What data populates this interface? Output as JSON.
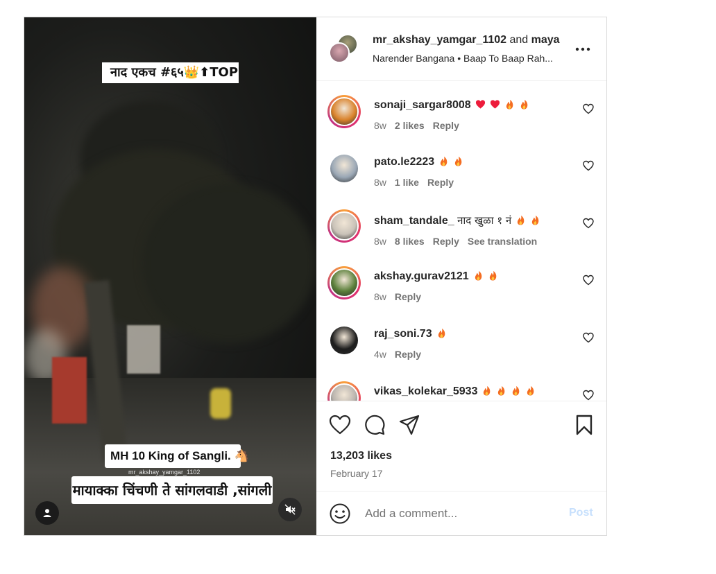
{
  "video": {
    "caption_top": "नाद एकच #६५👑⬆TOP",
    "caption_mh": "MH 10 King of Sangli. 🐴",
    "watermark": "mr_akshay_yamgar_1102",
    "caption_place": "मायाक्का चिंचणी ते सांगलवाडी ,सांगली"
  },
  "header": {
    "user1": "mr_akshay_yamgar_1102",
    "and": "and",
    "user2": "maya",
    "subtitle": "Narender Bangana • Baap To Baap Rah..."
  },
  "comments": [
    {
      "user": "sonaji_sargar8008",
      "text": "",
      "emojis": [
        "heart",
        "heart",
        "fire",
        "fire"
      ],
      "time": "8w",
      "likes": "2 likes",
      "reply": "Reply",
      "translate": "",
      "ring": true,
      "avatar_color": "#d9822b"
    },
    {
      "user": "pato.le2223",
      "text": "",
      "emojis": [
        "fire",
        "fire"
      ],
      "time": "8w",
      "likes": "1 like",
      "reply": "Reply",
      "translate": "",
      "ring": false,
      "avatar_color": "#9aa7b5"
    },
    {
      "user": "sham_tandale_",
      "text": "नाद खुळा १ नं",
      "emojis": [
        "fire",
        "fire"
      ],
      "time": "8w",
      "likes": "8 likes",
      "reply": "Reply",
      "translate": "See translation",
      "ring": true,
      "avatar_color": "#c9c2b8"
    },
    {
      "user": "akshay.gurav2121",
      "text": "",
      "emojis": [
        "fire",
        "fire"
      ],
      "time": "8w",
      "likes": "",
      "reply": "Reply",
      "translate": "",
      "ring": true,
      "avatar_color": "#5b7f3a"
    },
    {
      "user": "raj_soni.73",
      "text": "",
      "emojis": [
        "fire"
      ],
      "time": "4w",
      "likes": "",
      "reply": "Reply",
      "translate": "",
      "ring": false,
      "avatar_color": "#1d1d1d"
    },
    {
      "user": "vikas_kolekar_5933",
      "text": "",
      "emojis": [
        "fire",
        "fire",
        "fire",
        "fire"
      ],
      "time": "",
      "likes": "",
      "reply": "",
      "translate": "",
      "ring": true,
      "avatar_color": "#b9b3ad"
    }
  ],
  "actions": {
    "likes": "13,203 likes",
    "date": "February 17"
  },
  "add_comment": {
    "placeholder": "Add a comment...",
    "post_label": "Post"
  },
  "colors": {
    "accent_link": "#0095f6",
    "post_disabled": "#c7e0fd",
    "heart_red": "#ed1c3b",
    "fire": "#f46d22"
  },
  "icons": [
    "user-tag-icon",
    "mute-icon",
    "more-icon",
    "heart-icon",
    "comment-icon",
    "share-icon",
    "bookmark-icon",
    "emoji-icon"
  ]
}
